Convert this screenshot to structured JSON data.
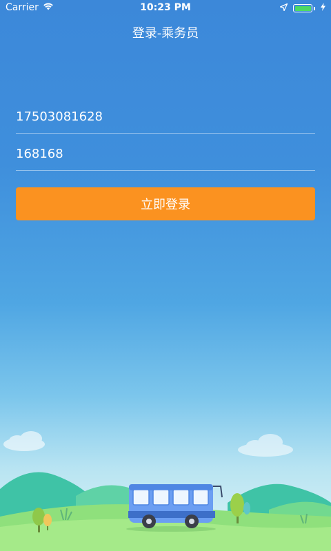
{
  "status_bar": {
    "carrier": "Carrier",
    "time": "10:23 PM",
    "battery_level": 1.0
  },
  "nav": {
    "title": "登录-乘务员"
  },
  "form": {
    "phone_value": "17503081628",
    "password_value": "168168",
    "login_label": "立即登录"
  },
  "colors": {
    "accent": "#fb9220",
    "background_top": "#3c88d9",
    "battery": "#4cd964"
  },
  "icons": [
    "wifi-icon",
    "location-arrow-icon",
    "battery-icon",
    "charging-bolt-icon",
    "bus-illustration",
    "cloud-icon",
    "tree-icon"
  ]
}
